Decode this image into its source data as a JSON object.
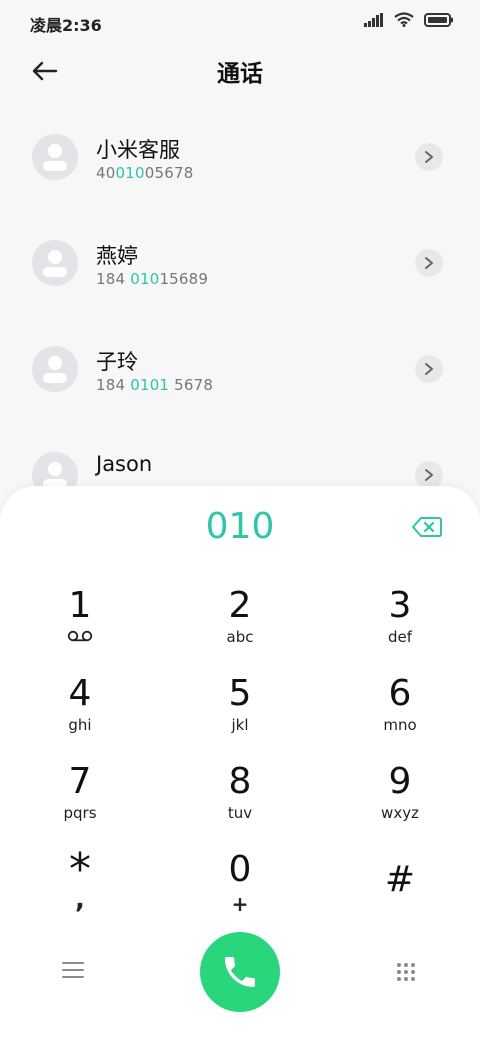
{
  "status_bar": {
    "time": "凌晨2:36",
    "icons": [
      "signal-icon",
      "wifi-icon",
      "battery-icon"
    ]
  },
  "header": {
    "title": "通话"
  },
  "contacts": [
    {
      "name": "小米客服",
      "num_pre": "40",
      "num_hl": "010",
      "num_post": "05678"
    },
    {
      "name": "燕婷",
      "num_pre": "184 ",
      "num_hl": "010",
      "num_post": "15689"
    },
    {
      "name": "子玲",
      "num_pre": "184 ",
      "num_hl": "0101",
      "num_post": " 5678"
    },
    {
      "name": "Jason",
      "num_pre": "",
      "num_hl": "",
      "num_post": ""
    }
  ],
  "dialer": {
    "entered": "010",
    "keys": [
      {
        "num": "1",
        "sub": ""
      },
      {
        "num": "2",
        "sub": "abc"
      },
      {
        "num": "3",
        "sub": "def"
      },
      {
        "num": "4",
        "sub": "ghi"
      },
      {
        "num": "5",
        "sub": "jkl"
      },
      {
        "num": "6",
        "sub": "mno"
      },
      {
        "num": "7",
        "sub": "pqrs"
      },
      {
        "num": "8",
        "sub": "tuv"
      },
      {
        "num": "9",
        "sub": "wxyz"
      },
      {
        "num": "*",
        "sub": ","
      },
      {
        "num": "0",
        "sub": "+"
      },
      {
        "num": "#",
        "sub": ""
      }
    ]
  },
  "colors": {
    "accent": "#2ec5a8",
    "call_button": "#29d67c"
  }
}
